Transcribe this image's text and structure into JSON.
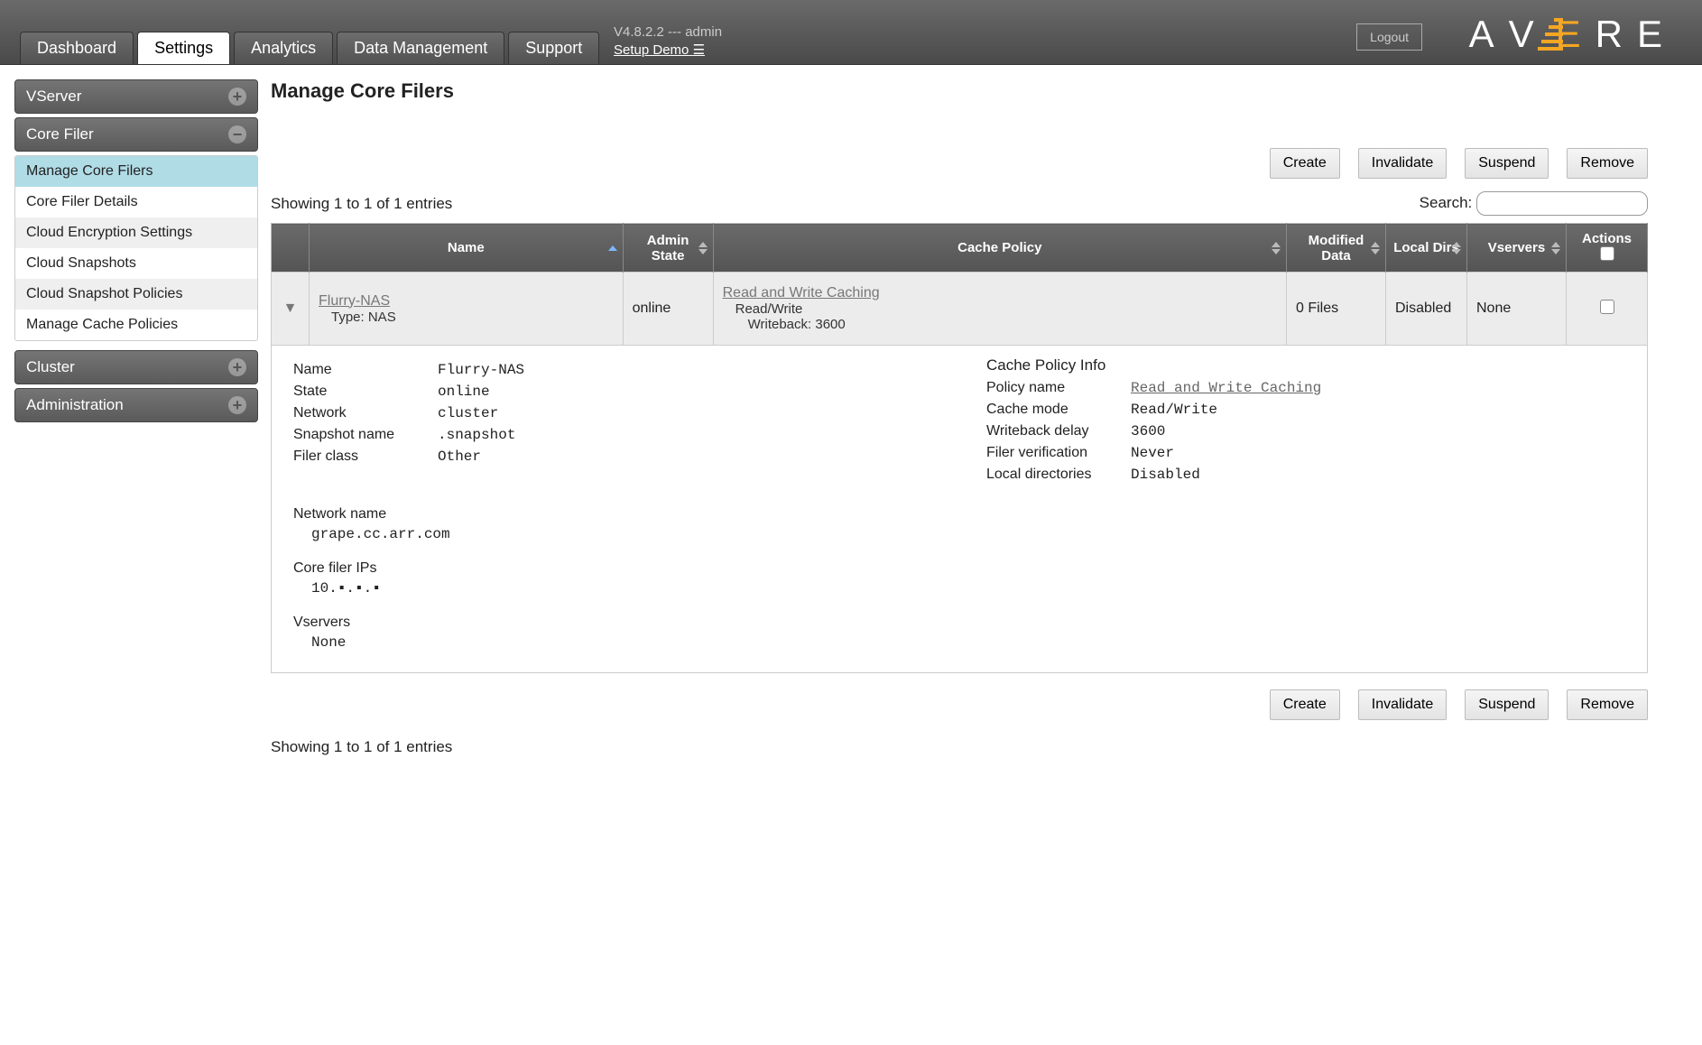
{
  "header": {
    "logout": "Logout",
    "version_line": "V4.8.2.2 --- admin",
    "setup_demo": "Setup Demo",
    "tabs": [
      "Dashboard",
      "Settings",
      "Analytics",
      "Data Management",
      "Support"
    ],
    "logo_letters": "AVERE"
  },
  "sidebar": {
    "sections": [
      {
        "title": "VServer",
        "icon": "plus",
        "items": []
      },
      {
        "title": "Core Filer",
        "icon": "minus",
        "items": [
          "Manage Core Filers",
          "Core Filer Details",
          "Cloud Encryption Settings",
          "Cloud Snapshots",
          "Cloud Snapshot Policies",
          "Manage Cache Policies"
        ],
        "selected_index": 0
      },
      {
        "title": "Cluster",
        "icon": "plus",
        "items": []
      },
      {
        "title": "Administration",
        "icon": "plus",
        "items": []
      }
    ]
  },
  "page": {
    "title": "Manage Core Filers",
    "buttons": {
      "create": "Create",
      "invalidate": "Invalidate",
      "suspend": "Suspend",
      "remove": "Remove"
    },
    "showing": "Showing 1 to 1 of 1 entries",
    "search_label": "Search:",
    "search_value": "",
    "columns": [
      "",
      "Name",
      "Admin State",
      "Cache Policy",
      "Modified Data",
      "Local Dirs",
      "Vservers",
      "Actions"
    ],
    "row": {
      "name": "Flurry-NAS",
      "type_line": "Type: NAS",
      "admin_state": "online",
      "cache_policy_name": "Read and Write Caching",
      "cache_mode": "Read/Write",
      "writeback_line": "Writeback: 3600",
      "modified_data": "0 Files",
      "local_dirs": "Disabled",
      "vservers": "None"
    },
    "details": {
      "left": {
        "Name": "Flurry-NAS",
        "State": "online",
        "Network": "cluster",
        "Snapshot name": ".snapshot",
        "Filer class": "Other"
      },
      "right_heading": "Cache Policy Info",
      "right": {
        "Policy name": "Read and Write Caching",
        "Cache mode": "Read/Write",
        "Writeback delay": "3600",
        "Filer verification": "Never",
        "Local directories": "Disabled"
      },
      "network_name_label": "Network name",
      "network_name": "grape.cc.arr.com",
      "core_ips_label": "Core filer IPs",
      "core_ips": "10.▪.▪.▪",
      "vservers_label": "Vservers",
      "vservers": "None"
    }
  }
}
